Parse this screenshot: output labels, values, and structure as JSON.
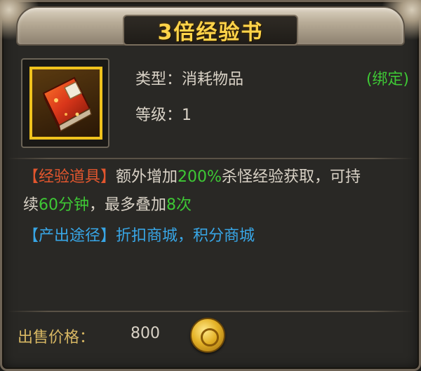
{
  "title": "3倍经验书",
  "item": {
    "icon": "red-book-icon",
    "type_label": "类型：",
    "type_value": "消耗物品",
    "level_label": "等级：",
    "level_value": "1",
    "bind_status": "(绑定)"
  },
  "description": {
    "tag_experience": "【经验道具】",
    "line1_text_a": "额外增加",
    "bonus_percent": "200%",
    "line1_text_b": "杀怪经验获取，可持",
    "line2_text_a": "续",
    "duration": "60分钟",
    "line2_text_b": "，最多叠加",
    "max_stack": "8次",
    "tag_source": "【产出途径】",
    "source_text": "折扣商城，积分商城"
  },
  "sell": {
    "label": "出售价格：",
    "price": "800",
    "currency_icon": "gold-coin-icon"
  },
  "colors": {
    "title": "#ffd44a",
    "green": "#3ec835",
    "red_tag": "#e2562e",
    "blue_tag": "#38a6e6",
    "sell_label": "#d7b763"
  }
}
